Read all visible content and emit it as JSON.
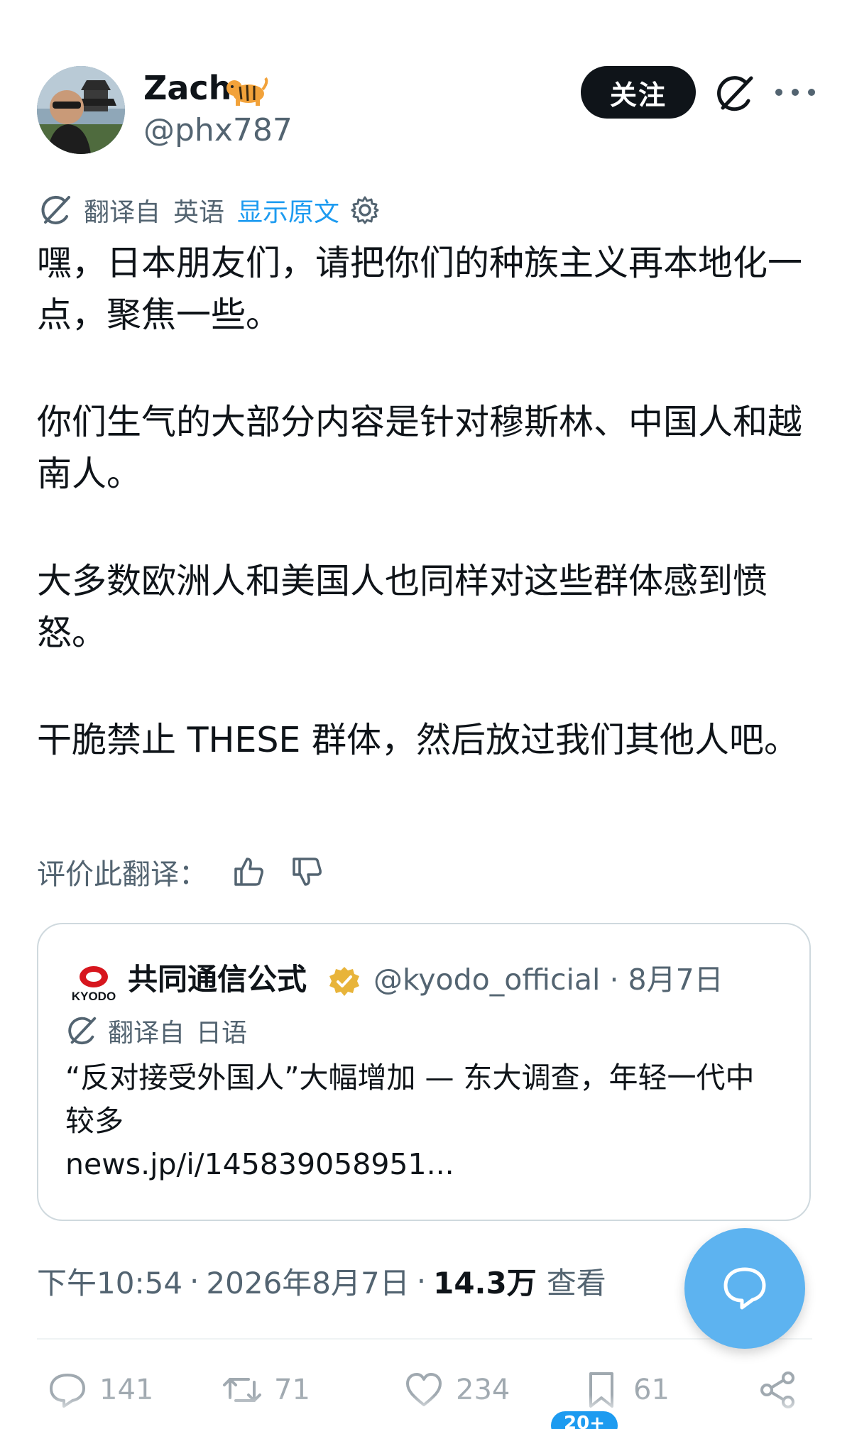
{
  "author": {
    "display_name": "Zach",
    "name_emoji": "tiger-emoji",
    "handle": "@phx787"
  },
  "header": {
    "follow_label": "关注",
    "grok_icon": "grok-icon",
    "more_icon": "more-icon"
  },
  "translation": {
    "translated_from": "翻译自",
    "language": "英语",
    "show_original": "显示原文"
  },
  "tweet": {
    "paragraphs": [
      "嘿，日本朋友们，请把你们的种族主义再本地化一点，聚焦一些。",
      "你们生气的大部分内容是针对穆斯林、中国人和越南人。",
      "大多数欧洲人和美国人也同样对这些群体感到愤怒。",
      "干脆禁止 THESE 群体，然后放过我们其他人吧。"
    ]
  },
  "rate": {
    "label": "评价此翻译："
  },
  "quote": {
    "logo_text": "KYODO",
    "name": "共同通信公式",
    "handle_date": "@kyodo_official · 8月7日",
    "translated_from": "翻译自",
    "language": "日语",
    "text": "“反对接受外国人”大幅增加 — 东大调查，年轻一代中较多",
    "link": "news.jp/i/145839058951..."
  },
  "meta": {
    "time": "下午10:54",
    "date": "2026年8月7日",
    "views_count": "14.3万",
    "views_label": "查看"
  },
  "actions": {
    "replies": "141",
    "reposts": "71",
    "likes": "234",
    "bookmarks": "61"
  },
  "new_posts_pill": "20+",
  "colors": {
    "accent": "#1d9bf0",
    "text": "#0f1419",
    "secondary": "#536471",
    "border": "#cfd9de",
    "verified_gold": "#e8b43a",
    "kyodo_red": "#d7161e"
  }
}
